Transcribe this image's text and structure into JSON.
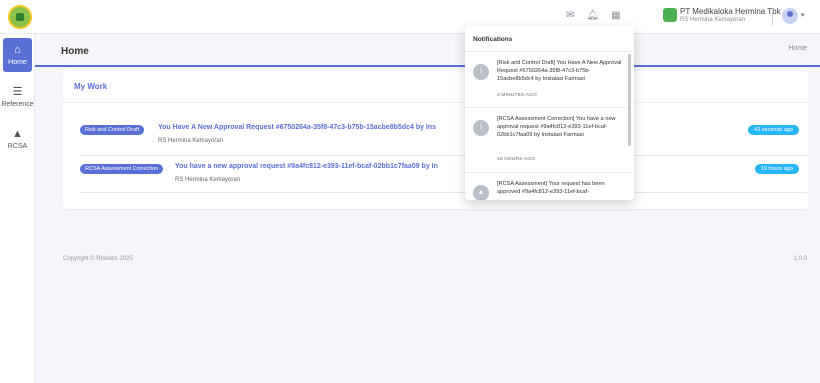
{
  "topbar": {
    "company_name": "PT Medikaloka Hermina Tbk",
    "company_unit": "RS Hermina Kemayoran",
    "icons": [
      "mail-icon",
      "bell-icon",
      "grid-icon"
    ],
    "avatar_caret": "▾"
  },
  "sidebar": {
    "items": [
      {
        "label": "Home",
        "icon": "⌂",
        "icon_name": "dashboard-icon"
      },
      {
        "label": "Reference",
        "icon": "☰",
        "icon_name": "sliders-icon"
      },
      {
        "label": "RCSA",
        "icon": "▲",
        "icon_name": "warning-icon"
      }
    ]
  },
  "page": {
    "title": "Home",
    "breadcrumb": "Home"
  },
  "my_work": {
    "title": "My Work",
    "rows": [
      {
        "badge": "Risk and Control Draft",
        "message": "You Have A New Approval Request #6750264a-35f8-47c3-b75b-15acbe8b5dc4 by Ins",
        "origin": "RS Hermina Kemayoran",
        "time": "43 seconds ago"
      },
      {
        "badge": "RCSA Assessment Correction",
        "message": "You have a new approval request #9a4fc812-e393-11ef-bcaf-02bb1c7faa09 by In",
        "origin": "RS Hermina Kemayoran",
        "time": "19 hours ago"
      }
    ]
  },
  "footer": {
    "copyright": "Copyright © Riskobs 2025",
    "version": "1.0.0"
  },
  "notifications": {
    "title": "Notifications",
    "items": [
      {
        "icon": "i",
        "text": "[Risk and Control Draft] You Have A New Approval Request #6750264a-35f8-47c3-b75b-15acbe8b5dc4 by Instalasi Farmasi",
        "time": "3 MINUTES AGO"
      },
      {
        "icon": "i",
        "text": "[RCSA Assessment Correction] You have a new approval request #9a4fc812-e393-11ef-bcaf-02bb1c7faa09 by Instalasi Farmasi",
        "time": "19 HOURS AGO"
      },
      {
        "icon": "▲",
        "text": "[RCSA Assessment] Your request has been approved #9a4fc812-e393-11ef-bcaf-",
        "time": ""
      }
    ]
  },
  "colors": {
    "accent": "#5a6fd6",
    "time_badge": "#29b6f6"
  }
}
